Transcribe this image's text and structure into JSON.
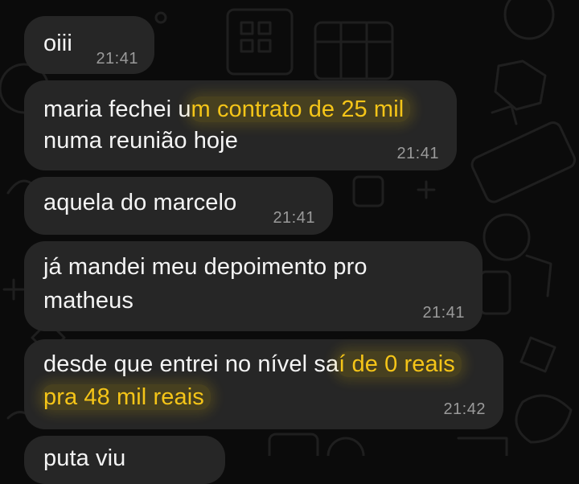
{
  "messages": [
    {
      "text": "oiii",
      "time": "21:41"
    },
    {
      "lines": [
        [
          "maria fechei u",
          "m contrato de 25 mil"
        ],
        [
          "numa reunião hoje",
          ""
        ]
      ],
      "time": "21:41"
    },
    {
      "text": "aquela do marcelo",
      "time": "21:41"
    },
    {
      "lines": [
        "já mandei meu depoimento pro",
        "matheus"
      ],
      "time": "21:41"
    },
    {
      "lines": [
        [
          "desde que entrei no nível sa",
          "í de 0 reais"
        ],
        [
          "",
          "pra 48 mil reais"
        ]
      ],
      "time": "21:42"
    },
    {
      "text": "puta viu"
    }
  ],
  "colors": {
    "background": "#0b0b0b",
    "bubble": "#262626",
    "text": "#f4f4f4",
    "timestamp": "#9a9a9a",
    "highlight": "#f5c518"
  }
}
